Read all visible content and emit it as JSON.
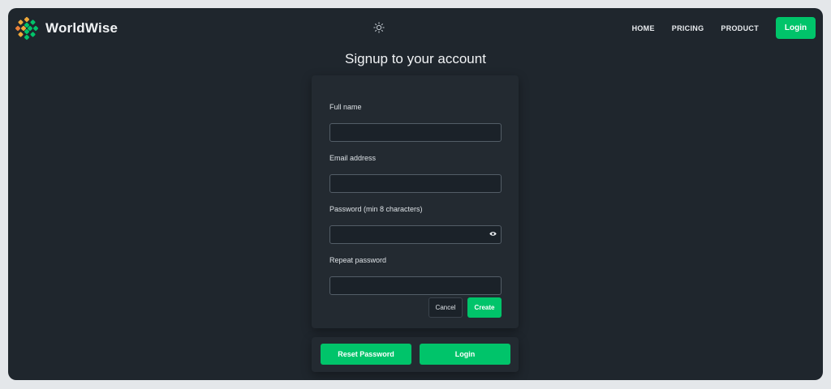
{
  "app": {
    "name": "WorldWise"
  },
  "nav": {
    "home": "HOME",
    "pricing": "PRICING",
    "product": "PRODUCT",
    "login": "Login"
  },
  "page": {
    "title": "Signup to your account"
  },
  "form": {
    "full_name_label": "Full name",
    "email_label": "Email address",
    "password_label": "Password (min 8 characters)",
    "repeat_password_label": "Repeat password",
    "full_name_value": "",
    "email_value": "",
    "password_value": "",
    "repeat_password_value": "",
    "cancel_label": "Cancel",
    "create_label": "Create"
  },
  "footer_actions": {
    "reset_password": "Reset Password",
    "login": "Login"
  },
  "icons": {
    "logo": "globe-logo-icon",
    "theme": "sun-icon",
    "password_toggle": "eye-icon"
  },
  "colors": {
    "accent": "#00c46a",
    "background": "#1f262d",
    "card": "#232a31"
  }
}
